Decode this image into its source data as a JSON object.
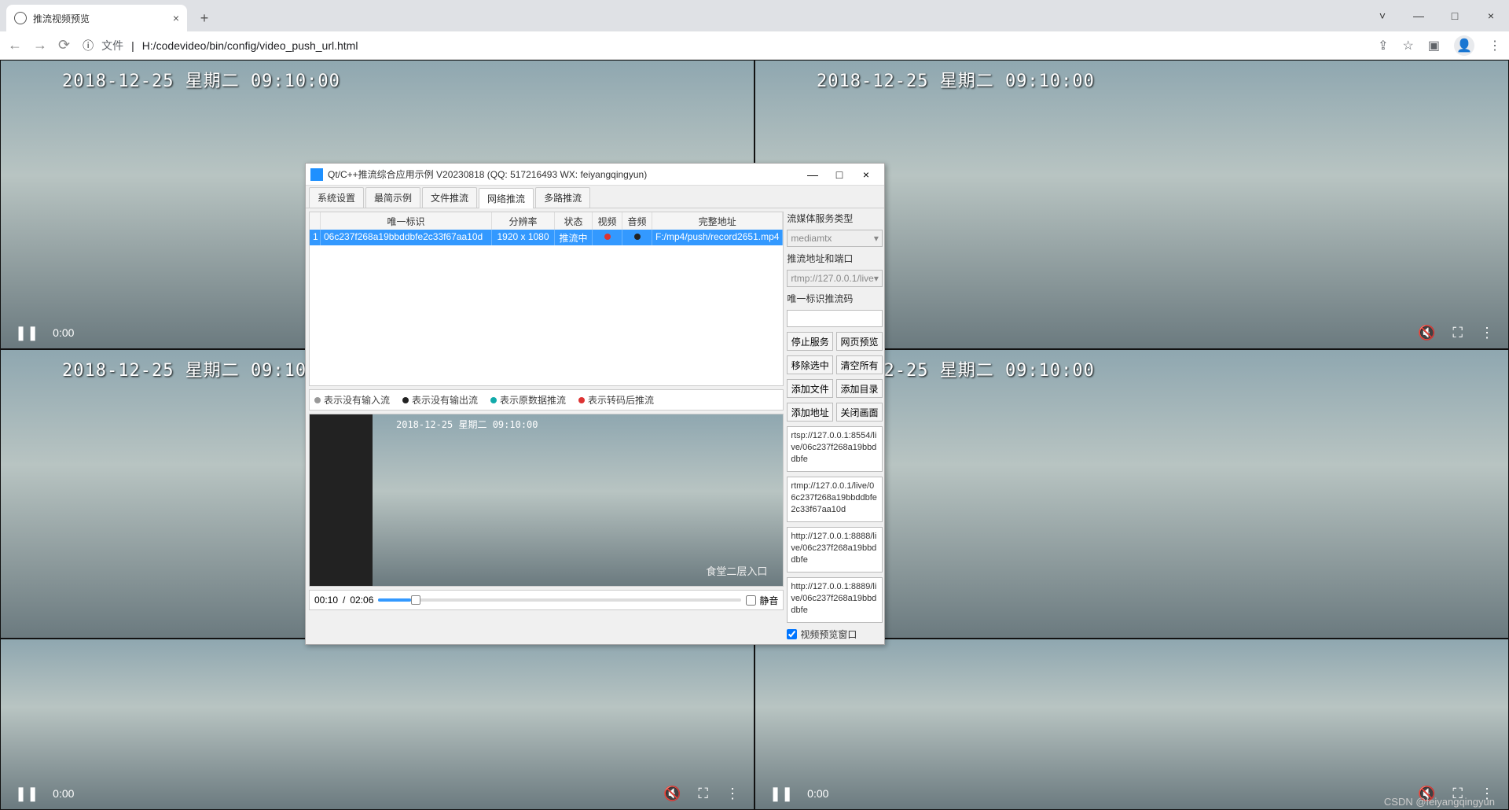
{
  "browser": {
    "tab_title": "推流视频预览",
    "file_label": "文件",
    "url": "H:/codevideo/bin/config/video_push_url.html"
  },
  "video": {
    "osd": "2018-12-25 星期二 09:10:00",
    "time": "0:00"
  },
  "dialog": {
    "title": "Qt/C++推流综合应用示例 V20230818 (QQ: 517216493 WX: feiyangqingyun)",
    "tabs": [
      "系统设置",
      "最简示例",
      "文件推流",
      "网络推流",
      "多路推流"
    ],
    "active_tab": 3,
    "table": {
      "headers": {
        "idx": "",
        "id": "唯一标识",
        "res": "分辨率",
        "st": "状态",
        "vd": "视频",
        "ad": "音频",
        "url": "完整地址"
      },
      "row": {
        "idx": "1",
        "id": "06c237f268a19bbddbfe2c33f67aa10d",
        "res": "1920 x 1080",
        "st": "推流中",
        "url": "F:/mp4/push/record2651.mp4"
      }
    },
    "legend": {
      "l1": "表示没有输入流",
      "l2": "表示没有输出流",
      "l3": "表示原数据推流",
      "l4": "表示转码后推流"
    },
    "preview": {
      "osd": "2018-12-25 星期二 09:10:00",
      "corner": "食堂二层入口"
    },
    "playbar": {
      "pos": "00:10",
      "dur": "02:06",
      "mute": "静音"
    },
    "side": {
      "lbl_service": "流媒体服务类型",
      "service": "mediamtx",
      "lbl_addr": "推流地址和端口",
      "addr": "rtmp://127.0.0.1/live",
      "lbl_code": "唯一标识推流码",
      "btns": {
        "stop": "停止服务",
        "web": "网页预览",
        "remove": "移除选中",
        "clear": "清空所有",
        "addfile": "添加文件",
        "adddir": "添加目录",
        "addurl": "添加地址",
        "close": "关闭画面"
      },
      "urls": [
        "rtsp://127.0.0.1:8554/live/06c237f268a19bbddbfe",
        "rtmp://127.0.0.1/live/06c237f268a19bbddbfe2c33f67aa10d",
        "http://127.0.0.1:8888/live/06c237f268a19bbddbfe",
        "http://127.0.0.1:8889/live/06c237f268a19bbddbfe"
      ],
      "chk": "视频预览窗口"
    }
  },
  "watermark": "CSDN @feiyangqingyun"
}
